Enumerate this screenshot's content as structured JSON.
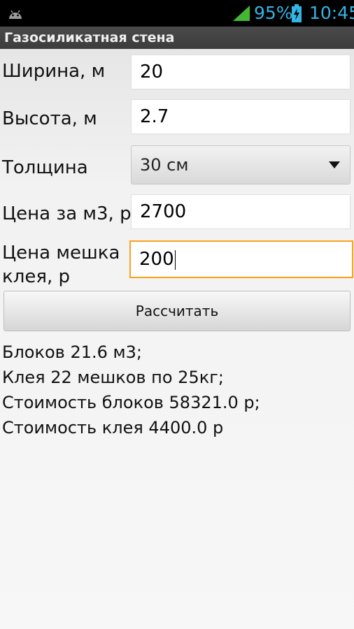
{
  "status_bar": {
    "battery_percent": "95%",
    "time": "10:45",
    "icons": [
      "android-icon",
      "signal-icon",
      "battery-charging-icon"
    ]
  },
  "title": "Газосиликатная стена",
  "form": {
    "width_label": "Ширина, м",
    "width_value": "20",
    "height_label": "Высота, м",
    "height_value": "2.7",
    "thickness_label": "Толщина",
    "thickness_selected": "30 см",
    "price_label": "Цена за м3, р",
    "price_value": "2700",
    "glue_price_label_line1": "Цена мешка",
    "glue_price_label_line2": "клея, р",
    "glue_price_value": "200"
  },
  "calculate_label": "Рассчитать",
  "results": [
    "Блоков 21.6 м3;",
    "Клея 22 мешков по 25кг;",
    "Стоимость блоков 58321.0 р;",
    "Стоимость клея 4400.0 р"
  ],
  "colors": {
    "status_accent": "#33b5e5",
    "focus_border": "#ff9f1a",
    "title_bar": "#424242"
  }
}
